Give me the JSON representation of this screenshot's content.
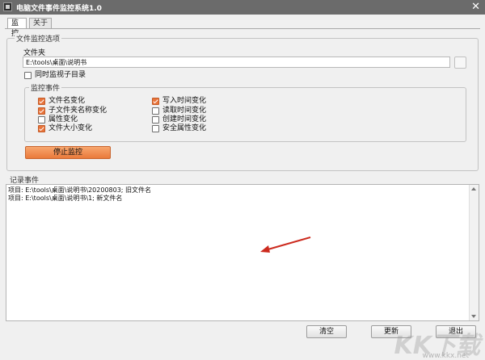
{
  "window": {
    "title": "电脑文件事件监控系统1.0",
    "close_glyph": "✕"
  },
  "tabs": [
    {
      "label": "监控"
    },
    {
      "label": "关于"
    }
  ],
  "monitor_group": {
    "label": "文件监控选项",
    "folder_label": "文件夹",
    "folder_path": "E:\\tools\\桌面\\说明书",
    "subdir_checkbox": {
      "label": "同时监视子目录",
      "checked": false
    }
  },
  "events_group": {
    "label": "监控事件",
    "left": [
      {
        "label": "文件名变化",
        "checked": true
      },
      {
        "label": "子文件夹名称变化",
        "checked": true
      },
      {
        "label": "属性变化",
        "checked": false
      },
      {
        "label": "文件大小变化",
        "checked": true
      }
    ],
    "right": [
      {
        "label": "写入时间变化",
        "checked": true
      },
      {
        "label": "读取时间变化",
        "checked": false
      },
      {
        "label": "创建时间变化",
        "checked": false
      },
      {
        "label": "安全属性变化",
        "checked": false
      }
    ]
  },
  "stop_button": "停止监控",
  "log": {
    "label": "记录事件",
    "lines": [
      "项目: E:\\tools\\桌面\\说明书\\20200803; 旧文件名",
      "项目: E:\\tools\\桌面\\说明书\\1; 新文件名"
    ]
  },
  "buttons": {
    "clear": "清空",
    "refresh": "更新",
    "exit": "退出"
  },
  "watermark": {
    "logo": "KK下载",
    "site": "www.kkx.net"
  },
  "colors": {
    "titlebar": "#6b6b6b",
    "accent": "#e8743b",
    "annotation_arrow": "#cc2a1e"
  }
}
